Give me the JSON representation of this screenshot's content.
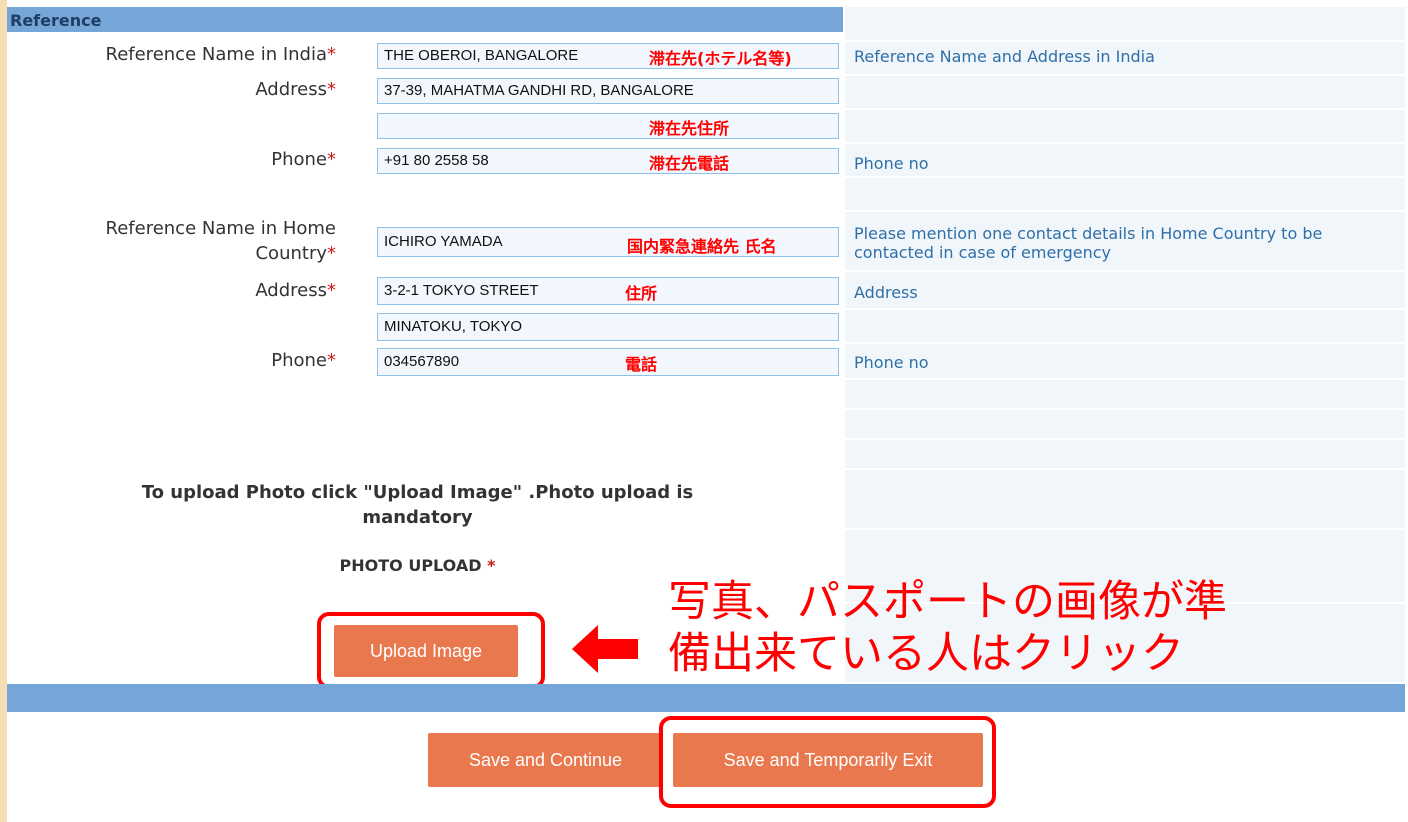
{
  "section": {
    "title": "Reference"
  },
  "india": {
    "name_label": "Reference Name in India",
    "name_value": "THE OBEROI, BANGALORE",
    "name_note": "滞在先(ホテル名等)",
    "name_hint": "Reference Name and Address in India",
    "address_label": "Address",
    "address1_value": "37-39, MAHATMA GANDHI RD, BANGALORE",
    "address2_value": "",
    "address_note": "滞在先住所",
    "phone_label": "Phone",
    "phone_value": "+91 80 2558 58",
    "phone_note": "滞在先電話",
    "phone_hint": "Phone no"
  },
  "home": {
    "name_label_line1": "Reference Name in Home",
    "name_label_line2": "Country",
    "name_value": "ICHIRO YAMADA",
    "name_note": "国内緊急連絡先 氏名",
    "name_hint_line1": "Please mention one contact details in Home Country to be",
    "name_hint_line2": "contacted in case of emergency",
    "address_label": "Address",
    "address1_value": "3-2-1 TOKYO STREET",
    "address_note": "住所",
    "address_hint": "Address",
    "address2_value": "MINATOKU, TOKYO",
    "phone_label": "Phone",
    "phone_value": "034567890",
    "phone_note": "電話",
    "phone_hint": "Phone no"
  },
  "required_mark": "*",
  "photo": {
    "instruction_line1": "To upload Photo click \"Upload Image\" .Photo upload is",
    "instruction_line2": "mandatory",
    "upload_label": "PHOTO UPLOAD",
    "upload_button": "Upload Image"
  },
  "annotation": {
    "line1": "写真、パスポートの画像が準",
    "line2": "備出来ている人はクリック"
  },
  "buttons": {
    "save_continue": "Save and Continue",
    "save_exit": "Save and Temporarily Exit"
  },
  "colors": {
    "header_bar": "#76a5d8",
    "button": "#e9784f",
    "highlight": "#ff0000",
    "hint_text": "#2f6fa8"
  },
  "icons": {
    "arrow": "left-arrow-icon"
  }
}
